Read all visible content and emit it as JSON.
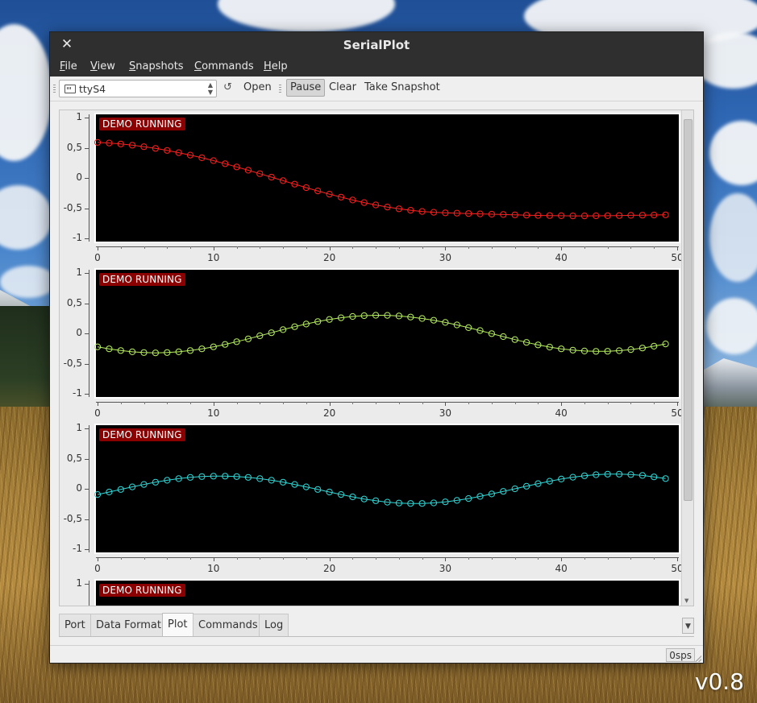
{
  "window": {
    "title": "SerialPlot",
    "close_glyph": "✕"
  },
  "menu": [
    {
      "id": "file",
      "label_u": "F",
      "label_rest": "ile"
    },
    {
      "id": "view",
      "label_u": "V",
      "label_rest": "iew"
    },
    {
      "id": "snapshots",
      "label_u": "S",
      "label_rest": "napshots"
    },
    {
      "id": "commands",
      "label_u": "C",
      "label_rest": "ommands"
    },
    {
      "id": "help",
      "label_u": "H",
      "label_rest": "elp"
    }
  ],
  "toolbar": {
    "port": "ttyS4",
    "refresh_glyph": "↺",
    "open_label": "Open",
    "pause_label": "Pause",
    "pause_pressed": true,
    "clear_label": "Clear",
    "snapshot_label": "Take Snapshot"
  },
  "plots": [
    {
      "badge": "DEMO RUNNING",
      "yticks": [
        "1",
        "0,5",
        "0",
        "-0,5",
        "-1"
      ],
      "xticks": [
        "0",
        "10",
        "20",
        "30",
        "40",
        "50"
      ]
    },
    {
      "badge": "DEMO RUNNING",
      "yticks": [
        "1",
        "0,5",
        "0",
        "-0,5",
        "-1"
      ],
      "xticks": [
        "0",
        "10",
        "20",
        "30",
        "40",
        "50"
      ]
    },
    {
      "badge": "DEMO RUNNING",
      "yticks": [
        "1",
        "0,5",
        "0",
        "-0,5",
        "-1"
      ],
      "xticks": [
        "0",
        "10",
        "20",
        "30",
        "40",
        "50"
      ]
    },
    {
      "badge": "DEMO RUNNING",
      "yticks": [
        "1"
      ]
    }
  ],
  "chart_data": [
    {
      "type": "line",
      "color": "#ff2020",
      "xlim": [
        0,
        50
      ],
      "ylim": [
        -1,
        1
      ],
      "x": [
        0,
        1,
        2,
        3,
        4,
        5,
        6,
        7,
        8,
        9,
        10,
        11,
        12,
        13,
        14,
        15,
        16,
        17,
        18,
        19,
        20,
        21,
        22,
        23,
        24,
        25,
        26,
        27,
        28,
        29,
        30,
        31,
        32,
        33,
        34,
        35,
        36,
        37,
        38,
        39,
        40,
        41,
        42,
        43,
        44,
        45,
        46,
        47,
        48,
        49
      ],
      "values": [
        0.59,
        0.579,
        0.563,
        0.543,
        0.518,
        0.489,
        0.456,
        0.419,
        0.378,
        0.334,
        0.286,
        0.236,
        0.183,
        0.128,
        0.071,
        0.013,
        -0.045,
        -0.103,
        -0.16,
        -0.215,
        -0.268,
        -0.318,
        -0.365,
        -0.408,
        -0.447,
        -0.481,
        -0.511,
        -0.535,
        -0.554,
        -0.568,
        -0.577,
        -0.583,
        -0.589,
        -0.595,
        -0.6,
        -0.606,
        -0.611,
        -0.616,
        -0.62,
        -0.623,
        -0.626,
        -0.628,
        -0.628,
        -0.627,
        -0.625,
        -0.622,
        -0.619,
        -0.616,
        -0.613,
        -0.61
      ]
    },
    {
      "type": "line",
      "color": "#b8f060",
      "xlim": [
        0,
        50
      ],
      "ylim": [
        -1,
        1
      ],
      "x": [
        0,
        1,
        2,
        3,
        4,
        5,
        6,
        7,
        8,
        9,
        10,
        11,
        12,
        13,
        14,
        15,
        16,
        17,
        18,
        19,
        20,
        21,
        22,
        23,
        24,
        25,
        26,
        27,
        28,
        29,
        30,
        31,
        32,
        33,
        34,
        35,
        36,
        37,
        38,
        39,
        40,
        41,
        42,
        43,
        44,
        45,
        46,
        47,
        48,
        49
      ],
      "values": [
        -0.222,
        -0.256,
        -0.284,
        -0.305,
        -0.318,
        -0.322,
        -0.318,
        -0.305,
        -0.284,
        -0.256,
        -0.222,
        -0.182,
        -0.138,
        -0.09,
        -0.04,
        0.011,
        0.061,
        0.11,
        0.155,
        0.196,
        0.231,
        0.259,
        0.28,
        0.294,
        0.3,
        0.298,
        0.288,
        0.271,
        0.247,
        0.217,
        0.181,
        0.14,
        0.094,
        0.046,
        -0.004,
        -0.054,
        -0.103,
        -0.149,
        -0.191,
        -0.227,
        -0.256,
        -0.278,
        -0.292,
        -0.298,
        -0.296,
        -0.286,
        -0.268,
        -0.243,
        -0.212,
        -0.175
      ]
    },
    {
      "type": "line",
      "color": "#30d8d8",
      "xlim": [
        0,
        50
      ],
      "ylim": [
        -1,
        1
      ],
      "x": [
        0,
        1,
        2,
        3,
        4,
        5,
        6,
        7,
        8,
        9,
        10,
        11,
        12,
        13,
        14,
        15,
        16,
        17,
        18,
        19,
        20,
        21,
        22,
        23,
        24,
        25,
        26,
        27,
        28,
        29,
        30,
        31,
        32,
        33,
        34,
        35,
        36,
        37,
        38,
        39,
        40,
        41,
        42,
        43,
        44,
        45,
        46,
        47,
        48,
        49
      ],
      "values": [
        -0.095,
        -0.053,
        -0.01,
        0.032,
        0.072,
        0.109,
        0.141,
        0.168,
        0.189,
        0.203,
        0.21,
        0.21,
        0.203,
        0.189,
        0.168,
        0.141,
        0.109,
        0.072,
        0.032,
        -0.01,
        -0.053,
        -0.095,
        -0.134,
        -0.169,
        -0.198,
        -0.221,
        -0.236,
        -0.243,
        -0.242,
        -0.233,
        -0.216,
        -0.192,
        -0.161,
        -0.125,
        -0.085,
        -0.043,
        0.0,
        0.043,
        0.085,
        0.125,
        0.161,
        0.192,
        0.216,
        0.233,
        0.242,
        0.243,
        0.236,
        0.221,
        0.198,
        0.169
      ]
    }
  ],
  "tabs": [
    {
      "label": "Port",
      "active": false
    },
    {
      "label": "Data Format",
      "active": false
    },
    {
      "label": "Plot",
      "active": true
    },
    {
      "label": "Commands",
      "active": false
    },
    {
      "label": "Log",
      "active": false
    }
  ],
  "status": {
    "rate": "0sps"
  },
  "desktop": {
    "version": "v0.8"
  }
}
